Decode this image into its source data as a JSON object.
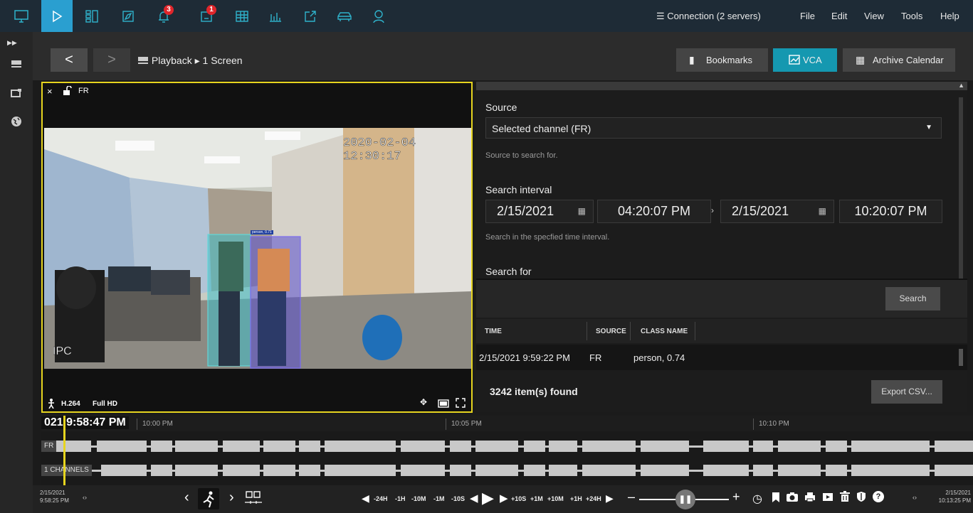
{
  "topbar": {
    "connection_label": "Connection (2 servers)",
    "menu": [
      "File",
      "Edit",
      "View",
      "Tools",
      "Help"
    ],
    "tools": [
      {
        "icon": "monitor-icon"
      },
      {
        "icon": "play-icon",
        "active": true
      },
      {
        "icon": "grid-layout-icon"
      },
      {
        "icon": "compass-icon"
      },
      {
        "icon": "bell-icon",
        "badge": "3"
      },
      {
        "icon": "alert-doc-icon",
        "badge": "1"
      },
      {
        "icon": "table-icon"
      },
      {
        "icon": "bar-chart-icon"
      },
      {
        "icon": "export-icon"
      },
      {
        "icon": "car-icon"
      },
      {
        "icon": "face-icon"
      }
    ],
    "accent": "#2fb3cc",
    "badge_color": "#e0262b"
  },
  "sidebar": {
    "icons": [
      "expand-icon",
      "screen-icon",
      "monitor-add-icon",
      "globe-icon"
    ]
  },
  "nav": {
    "back": "<",
    "forward": ">",
    "breadcrumb_root": "Playback",
    "breadcrumb_leaf": "1 Screen",
    "bookmarks": "Bookmarks",
    "vca": "VCA",
    "archive_calendar": "Archive Calendar"
  },
  "video": {
    "close": "×",
    "channel": "FR",
    "osd_timestamp": "2020-02-04 12:30:17",
    "osd_label": "IPC",
    "codec": "H.264",
    "resolution": "Full HD",
    "detection_label": "person, 0.71",
    "frame_border": "#e6d41f"
  },
  "vca_panel": {
    "source_title": "Source",
    "source_value": "Selected channel (FR)",
    "source_hint": "Source to search for.",
    "interval_title": "Search interval",
    "start_date": "2/15/2021",
    "start_time": "04:20:07 PM",
    "end_date": "2/15/2021",
    "end_time": "10:20:07 PM",
    "interval_hint": "Search in the specfied time interval.",
    "search_for_title": "Search for",
    "search_button": "Search",
    "columns": [
      "TIME",
      "SOURCE",
      "CLASS NAME"
    ],
    "rows": [
      {
        "time": "2/15/2021 9:59:22 PM",
        "source": "FR",
        "class": "person, 0.74"
      }
    ],
    "found": "3242 item(s) found",
    "export": "Export CSV..."
  },
  "timeline": {
    "current_time": "021 9:58:47 PM",
    "ticks": [
      "10:00 PM",
      "10:05 PM",
      "10:10 PM"
    ],
    "track1": "FR",
    "track2": "1 CHANNELS"
  },
  "bottombar": {
    "start_date": "2/15/2021",
    "start_time": "9:58:25 PM",
    "end_date": "2/15/2021",
    "end_time": "10:13:25 PM",
    "steps_back": [
      "-24H",
      "-1H",
      "-10M",
      "-1M",
      "-10S"
    ],
    "steps_fwd": [
      "+10S",
      "+1M",
      "+10M",
      "+1H",
      "+24H"
    ]
  }
}
